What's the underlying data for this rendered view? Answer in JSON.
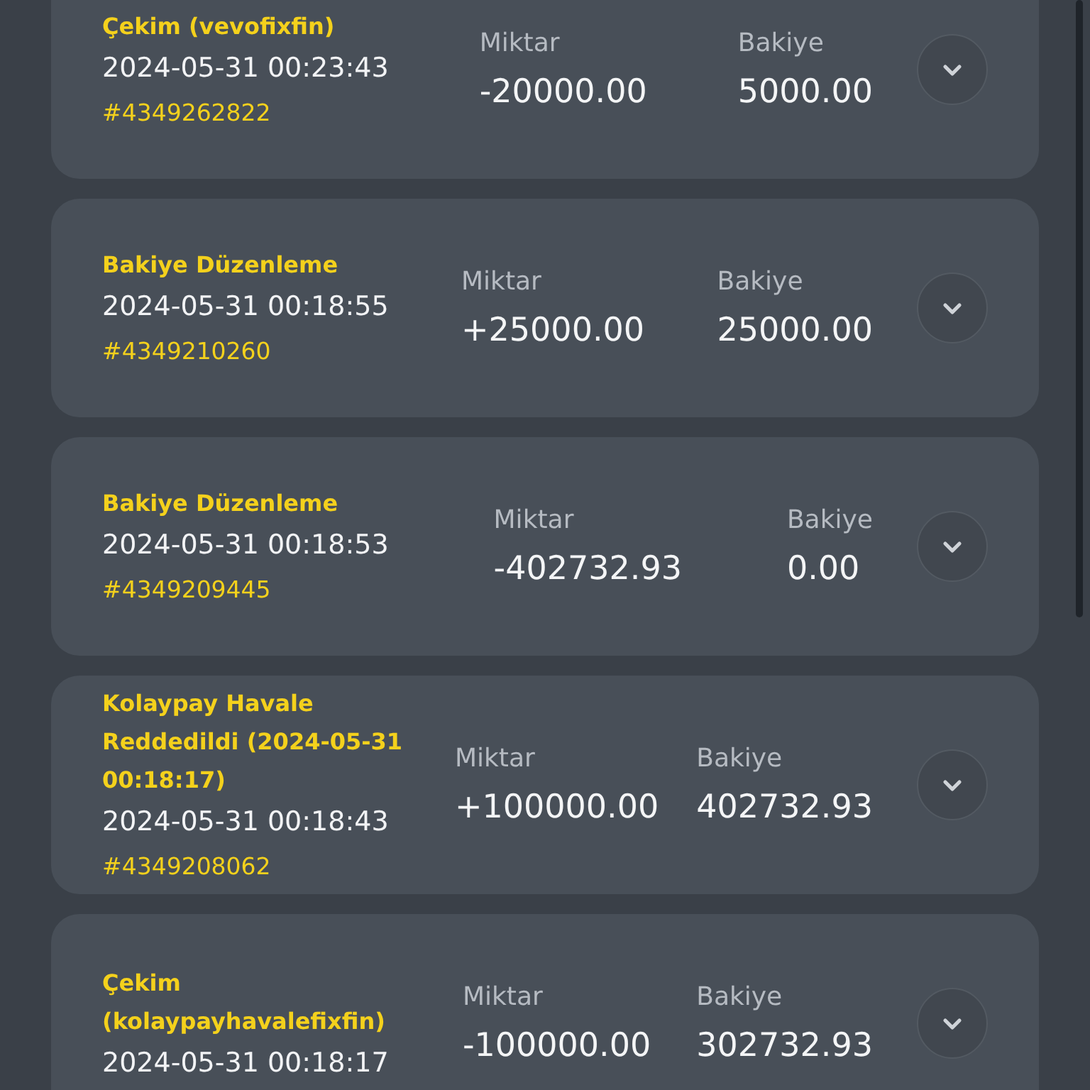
{
  "transactions": [
    {
      "title": "Çekim (vevofixfin)",
      "date": "2024-05-31 00:23:43",
      "id": "#4349262822",
      "amount_label": "Miktar",
      "amount": "-20000.00",
      "balance_label": "Bakiye",
      "balance": "5000.00",
      "expanded": false
    },
    {
      "title": "Bakiye Düzenleme",
      "date": "2024-05-31 00:18:55",
      "id": "#4349210260",
      "amount_label": "Miktar",
      "amount": "+25000.00",
      "balance_label": "Bakiye",
      "balance": "25000.00",
      "expanded": false
    },
    {
      "title": "Bakiye Düzenleme",
      "date": "2024-05-31 00:18:53",
      "id": "#4349209445",
      "amount_label": "Miktar",
      "amount": "-402732.93",
      "balance_label": "Bakiye",
      "balance": "0.00",
      "expanded": false
    },
    {
      "title": "Kolaypay Havale Reddedildi (2024-05-31 00:18:17)",
      "date": "2024-05-31 00:18:43",
      "id": "#4349208062",
      "amount_label": "Miktar",
      "amount": "+100000.00",
      "balance_label": "Bakiye",
      "balance": "402732.93",
      "expanded": false
    },
    {
      "title": "Çekim (kolaypayhavalefixfin)",
      "date": "2024-05-31 00:18:17",
      "amount_label": "Miktar",
      "amount": "-100000.00",
      "balance_label": "Bakiye",
      "balance": "302732.93",
      "expanded": false
    }
  ]
}
